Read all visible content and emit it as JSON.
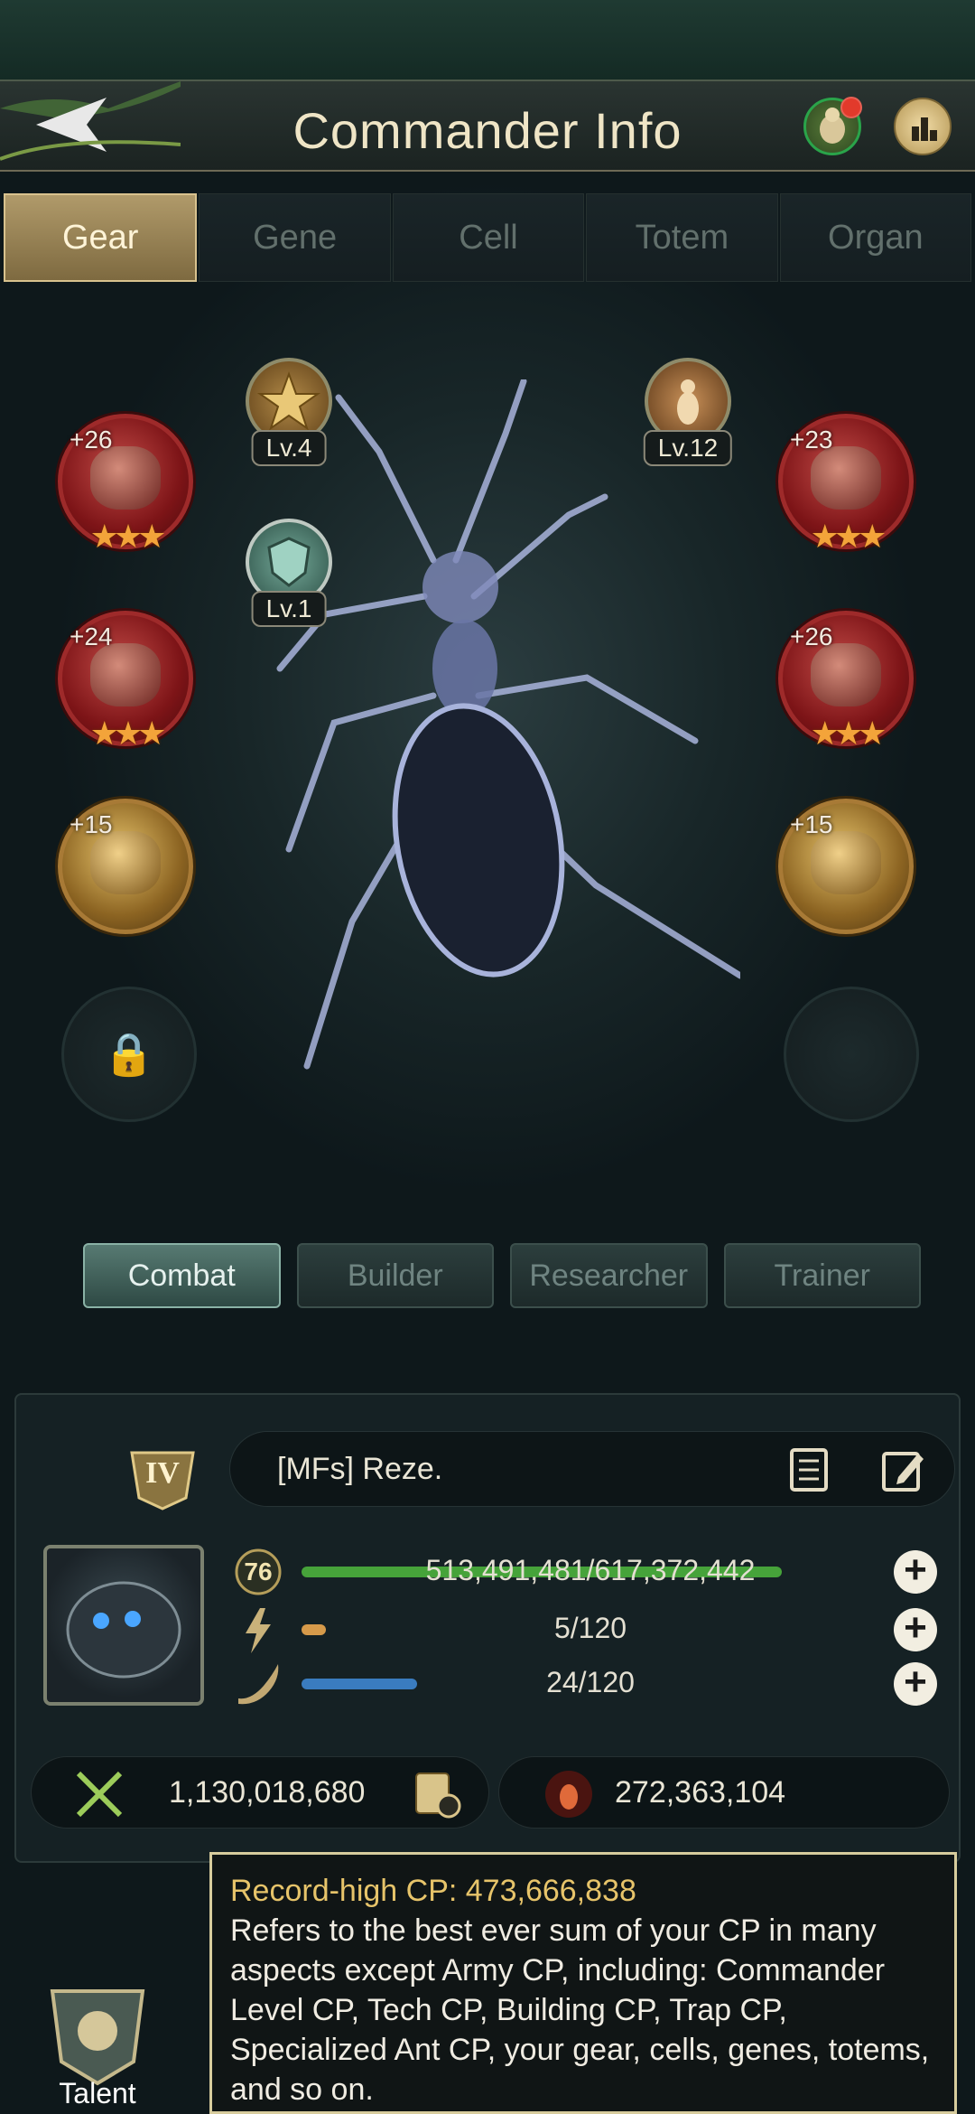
{
  "header": {
    "title": "Commander Info",
    "back_icon": "back-arrow-icon",
    "notify_icon": "queen-ant-icon",
    "rank_icon": "leaderboard-icon"
  },
  "tabs": [
    {
      "label": "Gear",
      "active": true
    },
    {
      "label": "Gene",
      "active": false
    },
    {
      "label": "Cell",
      "active": false
    },
    {
      "label": "Totem",
      "active": false
    },
    {
      "label": "Organ",
      "active": false
    }
  ],
  "gear": {
    "left": [
      {
        "plus": "+26",
        "stars": "★★★"
      },
      {
        "plus": "+24",
        "stars": "★★★"
      },
      {
        "plus": "+15"
      },
      {
        "locked": true
      }
    ],
    "right": [
      {
        "plus": "+23",
        "stars": "★★★"
      },
      {
        "plus": "+26",
        "stars": "★★★"
      },
      {
        "plus": "+15"
      },
      {
        "empty": true
      }
    ],
    "badges": [
      {
        "level": "Lv.4",
        "icon": "star-medal-icon"
      },
      {
        "level": "Lv.1",
        "icon": "shield-medal-icon"
      },
      {
        "level": "Lv.12",
        "icon": "ant-medal-icon"
      }
    ],
    "lock_icon": "lock-icon"
  },
  "roles": [
    {
      "label": "Combat",
      "active": true
    },
    {
      "label": "Builder",
      "active": false
    },
    {
      "label": "Researcher",
      "active": false
    },
    {
      "label": "Trainer",
      "active": false
    }
  ],
  "commander": {
    "rank": "IV",
    "name": "[MFs]  Reze.",
    "level": "76",
    "exp": {
      "text": "513,491,481/617,372,442",
      "fraction": 0.832
    },
    "energy": {
      "text": "5/120",
      "fraction": 0.042
    },
    "stamina": {
      "text": "24/120",
      "fraction": 0.2
    },
    "power": "1,130,018,680",
    "army": "272,363,104"
  },
  "tooltip": {
    "title": "Record-high CP: 473,666,838",
    "body": "Refers to the best ever sum of your CP in many aspects except Army CP, including: Commander Level CP, Tech CP, Building CP, Trap CP, Specialized Ant CP, your gear, cells, genes, totems, and so on."
  },
  "talent": {
    "label": "Talent"
  }
}
